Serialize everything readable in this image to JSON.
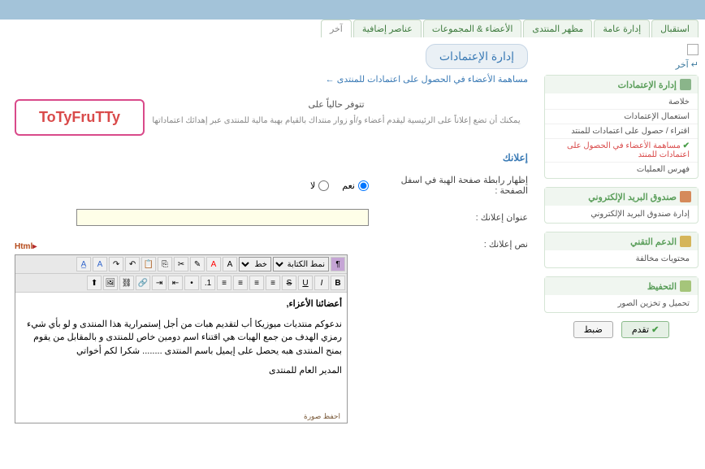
{
  "tabs": {
    "items": [
      {
        "label": "استقبال"
      },
      {
        "label": "إدارة عامة"
      },
      {
        "label": "مظهر المنتدى"
      },
      {
        "label": "الأعضاء & المجموعات"
      },
      {
        "label": "عناصر إضافية"
      },
      {
        "label": "آخر"
      }
    ]
  },
  "breadcrumb": "↵ آخر",
  "page_title": "إدارة الإعتمادات",
  "subtitle_arrow": "←",
  "subtitle": "مساهمة الأعضاء في الحصول على اعتمادات للمنتدى",
  "desc_line1": "تتوفر حالياً على",
  "desc_line2": "يمكنك أن تضع إعلاناً على الرئيسية ليقدم أعضاء و/أو زوار منتداك بالقيام بهبة مالية للمنتدى عبر إهدائك اعتماداتها",
  "brand": "ToTyFruTTy",
  "section_ad": "إعلانك",
  "form": {
    "show_footer_label": "إظهار رابطة صفحة الهبة في اسفل الصفحة :",
    "yes": "نعم",
    "no": "لا",
    "ad_title_label": "عنوان إعلانك :",
    "ad_title_value": "",
    "ad_text_label": "نص إعلانك :"
  },
  "editor": {
    "style_select": "نمط الكتابة",
    "font_select": "",
    "img_host": "احفظ صورة",
    "content_line1": "أعضائنا الأعزاء,",
    "content_line2": "ندعوكم منتديات ميوزيكا أب لتقديم هبات من أجل إستمرارية هذا المنتدى و لو بأي شيء رمزي الهدف من جمع الهبات هي اقتناء اسم دومين خاص للمنتدى و بالمقابل من يقوم بمنح المنتدى هبه يحصل على إيميل باسم المنتدى ........ شكرا لكم أخواتي",
    "content_line3": "المدير العام للمنتدى"
  },
  "html_badge": "Html",
  "sidebar": {
    "panel1": {
      "title": "إدارة الإعتمادات",
      "items": [
        "خلاصة",
        "استعمال الإعتمادات",
        "اقتراء / حصول على اعتمادات للمنتد",
        "مساهمة الأعضاء في الحصول على اعتمادات للمنتد",
        "فهرس العمليات"
      ]
    },
    "panel2": {
      "title": "صندوق البريد الإلكتروني",
      "items": [
        "إدارة صندوق البريد الإلكتروني"
      ]
    },
    "panel3": {
      "title": "الدعم التقني",
      "items": [
        "محتويات مخالفة"
      ]
    },
    "panel4": {
      "title": "التحفيظ",
      "items": [
        "تحميل و تخزين الصور"
      ]
    }
  },
  "buttons": {
    "save": "تقدم",
    "reset": "ضبط"
  }
}
